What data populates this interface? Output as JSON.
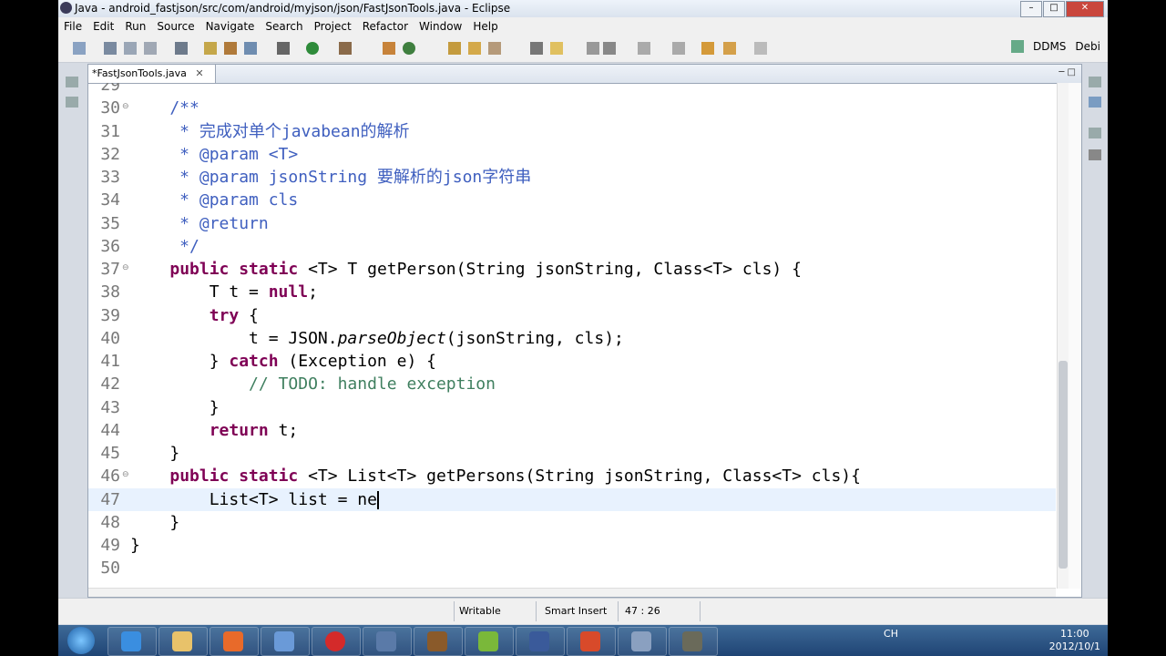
{
  "window": {
    "title": "Java - android_fastjson/src/com/android/myjson/json/FastJsonTools.java - Eclipse"
  },
  "menu": [
    "File",
    "Edit",
    "Run",
    "Source",
    "Navigate",
    "Search",
    "Project",
    "Refactor",
    "Window",
    "Help"
  ],
  "perspectives": {
    "ddms": "DDMS",
    "debug": "Debi"
  },
  "editor": {
    "tab_label": "*FastJsonTools.java",
    "lines": [
      {
        "n": "29",
        "html": ""
      },
      {
        "n": "30",
        "html": "<span class=\"jc\">    /**</span>",
        "fold": true
      },
      {
        "n": "31",
        "html": "<span class=\"jc\">     * 完成对单个javabean的解析</span>"
      },
      {
        "n": "32",
        "html": "<span class=\"jc\">     * @param &lt;T&gt;</span>"
      },
      {
        "n": "33",
        "html": "<span class=\"jc\">     * @param jsonString 要解析的json字符串</span>"
      },
      {
        "n": "34",
        "html": "<span class=\"jc\">     * @param cls</span>"
      },
      {
        "n": "35",
        "html": "<span class=\"jc\">     * @return</span>"
      },
      {
        "n": "36",
        "html": "<span class=\"jc\">     */</span>"
      },
      {
        "n": "37",
        "html": "    <span class=\"k\">public static</span> &lt;T&gt; T getPerson(String jsonString, Class&lt;T&gt; cls) {",
        "fold": true
      },
      {
        "n": "38",
        "html": "        T t = <span class=\"k\">null</span>;"
      },
      {
        "n": "39",
        "html": "        <span class=\"k\">try</span> {"
      },
      {
        "n": "40",
        "html": "            t = JSON.<span class=\"it\">parseObject</span>(jsonString, cls);"
      },
      {
        "n": "41",
        "html": "        } <span class=\"k\">catch</span> (Exception e) {"
      },
      {
        "n": "42",
        "html": "            <span class=\"cm\">// TODO: handle exception</span>"
      },
      {
        "n": "43",
        "html": "        }"
      },
      {
        "n": "44",
        "html": "        <span class=\"k\">return</span> t;"
      },
      {
        "n": "45",
        "html": "    }"
      },
      {
        "n": "46",
        "html": "    <span class=\"k\">public static</span> &lt;T&gt; List&lt;T&gt; getPersons(String jsonString, Class&lt;T&gt; cls){",
        "fold": true
      },
      {
        "n": "47",
        "html": "        List&lt;T&gt; list = ne<span class=\"cursor\"></span>",
        "current": true
      },
      {
        "n": "48",
        "html": "    }"
      },
      {
        "n": "49",
        "html": "}"
      },
      {
        "n": "50",
        "html": ""
      }
    ]
  },
  "status": {
    "mode": "Writable",
    "insert": "Smart Insert",
    "position": "47 : 26"
  },
  "taskbar": {
    "lang": "CH",
    "time": "11:00",
    "date": "2012/10/1"
  },
  "colors": {
    "keyword": "#7f0055",
    "javadoc": "#3f5fbf",
    "comment": "#3f7f5f",
    "current_line": "#e8f2fe"
  }
}
